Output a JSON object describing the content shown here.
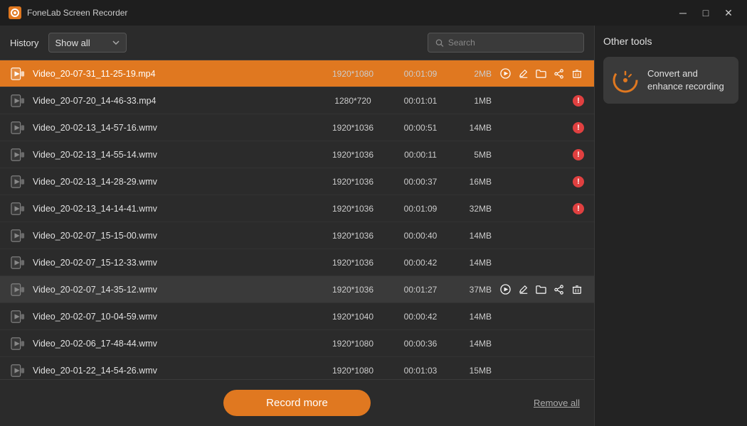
{
  "app": {
    "title": "FoneLab Screen Recorder"
  },
  "titlebar": {
    "minimize_label": "─",
    "maximize_label": "□",
    "close_label": "✕"
  },
  "toolbar": {
    "history_label": "History",
    "filter_value": "Show all",
    "search_placeholder": "Search"
  },
  "recordings": [
    {
      "id": 1,
      "name": "Video_20-07-31_11-25-19.mp4",
      "resolution": "1920*1080",
      "duration": "00:01:09",
      "size": "2MB",
      "active": true,
      "error": false,
      "show_actions": true
    },
    {
      "id": 2,
      "name": "Video_20-07-20_14-46-33.mp4",
      "resolution": "1280*720",
      "duration": "00:01:01",
      "size": "1MB",
      "active": false,
      "error": true,
      "show_actions": false
    },
    {
      "id": 3,
      "name": "Video_20-02-13_14-57-16.wmv",
      "resolution": "1920*1036",
      "duration": "00:00:51",
      "size": "14MB",
      "active": false,
      "error": true,
      "show_actions": false
    },
    {
      "id": 4,
      "name": "Video_20-02-13_14-55-14.wmv",
      "resolution": "1920*1036",
      "duration": "00:00:11",
      "size": "5MB",
      "active": false,
      "error": true,
      "show_actions": false
    },
    {
      "id": 5,
      "name": "Video_20-02-13_14-28-29.wmv",
      "resolution": "1920*1036",
      "duration": "00:00:37",
      "size": "16MB",
      "active": false,
      "error": true,
      "show_actions": false
    },
    {
      "id": 6,
      "name": "Video_20-02-13_14-14-41.wmv",
      "resolution": "1920*1036",
      "duration": "00:01:09",
      "size": "32MB",
      "active": false,
      "error": true,
      "show_actions": false
    },
    {
      "id": 7,
      "name": "Video_20-02-07_15-15-00.wmv",
      "resolution": "1920*1036",
      "duration": "00:00:40",
      "size": "14MB",
      "active": false,
      "error": false,
      "show_actions": false
    },
    {
      "id": 8,
      "name": "Video_20-02-07_15-12-33.wmv",
      "resolution": "1920*1036",
      "duration": "00:00:42",
      "size": "14MB",
      "active": false,
      "error": false,
      "show_actions": false
    },
    {
      "id": 9,
      "name": "Video_20-02-07_14-35-12.wmv",
      "resolution": "1920*1036",
      "duration": "00:01:27",
      "size": "37MB",
      "active": false,
      "error": false,
      "show_actions": true,
      "hovered": true
    },
    {
      "id": 10,
      "name": "Video_20-02-07_10-04-59.wmv",
      "resolution": "1920*1040",
      "duration": "00:00:42",
      "size": "14MB",
      "active": false,
      "error": false,
      "show_actions": false
    },
    {
      "id": 11,
      "name": "Video_20-02-06_17-48-44.wmv",
      "resolution": "1920*1080",
      "duration": "00:00:36",
      "size": "14MB",
      "active": false,
      "error": false,
      "show_actions": false
    },
    {
      "id": 12,
      "name": "Video_20-01-22_14-54-26.wmv",
      "resolution": "1920*1080",
      "duration": "00:01:03",
      "size": "15MB",
      "active": false,
      "error": false,
      "show_actions": false
    }
  ],
  "bottom": {
    "record_more_label": "Record more",
    "remove_all_label": "Remove all"
  },
  "right_panel": {
    "title": "Other tools",
    "tools": [
      {
        "label": "Convert and enhance recording",
        "icon": "convert"
      }
    ]
  }
}
